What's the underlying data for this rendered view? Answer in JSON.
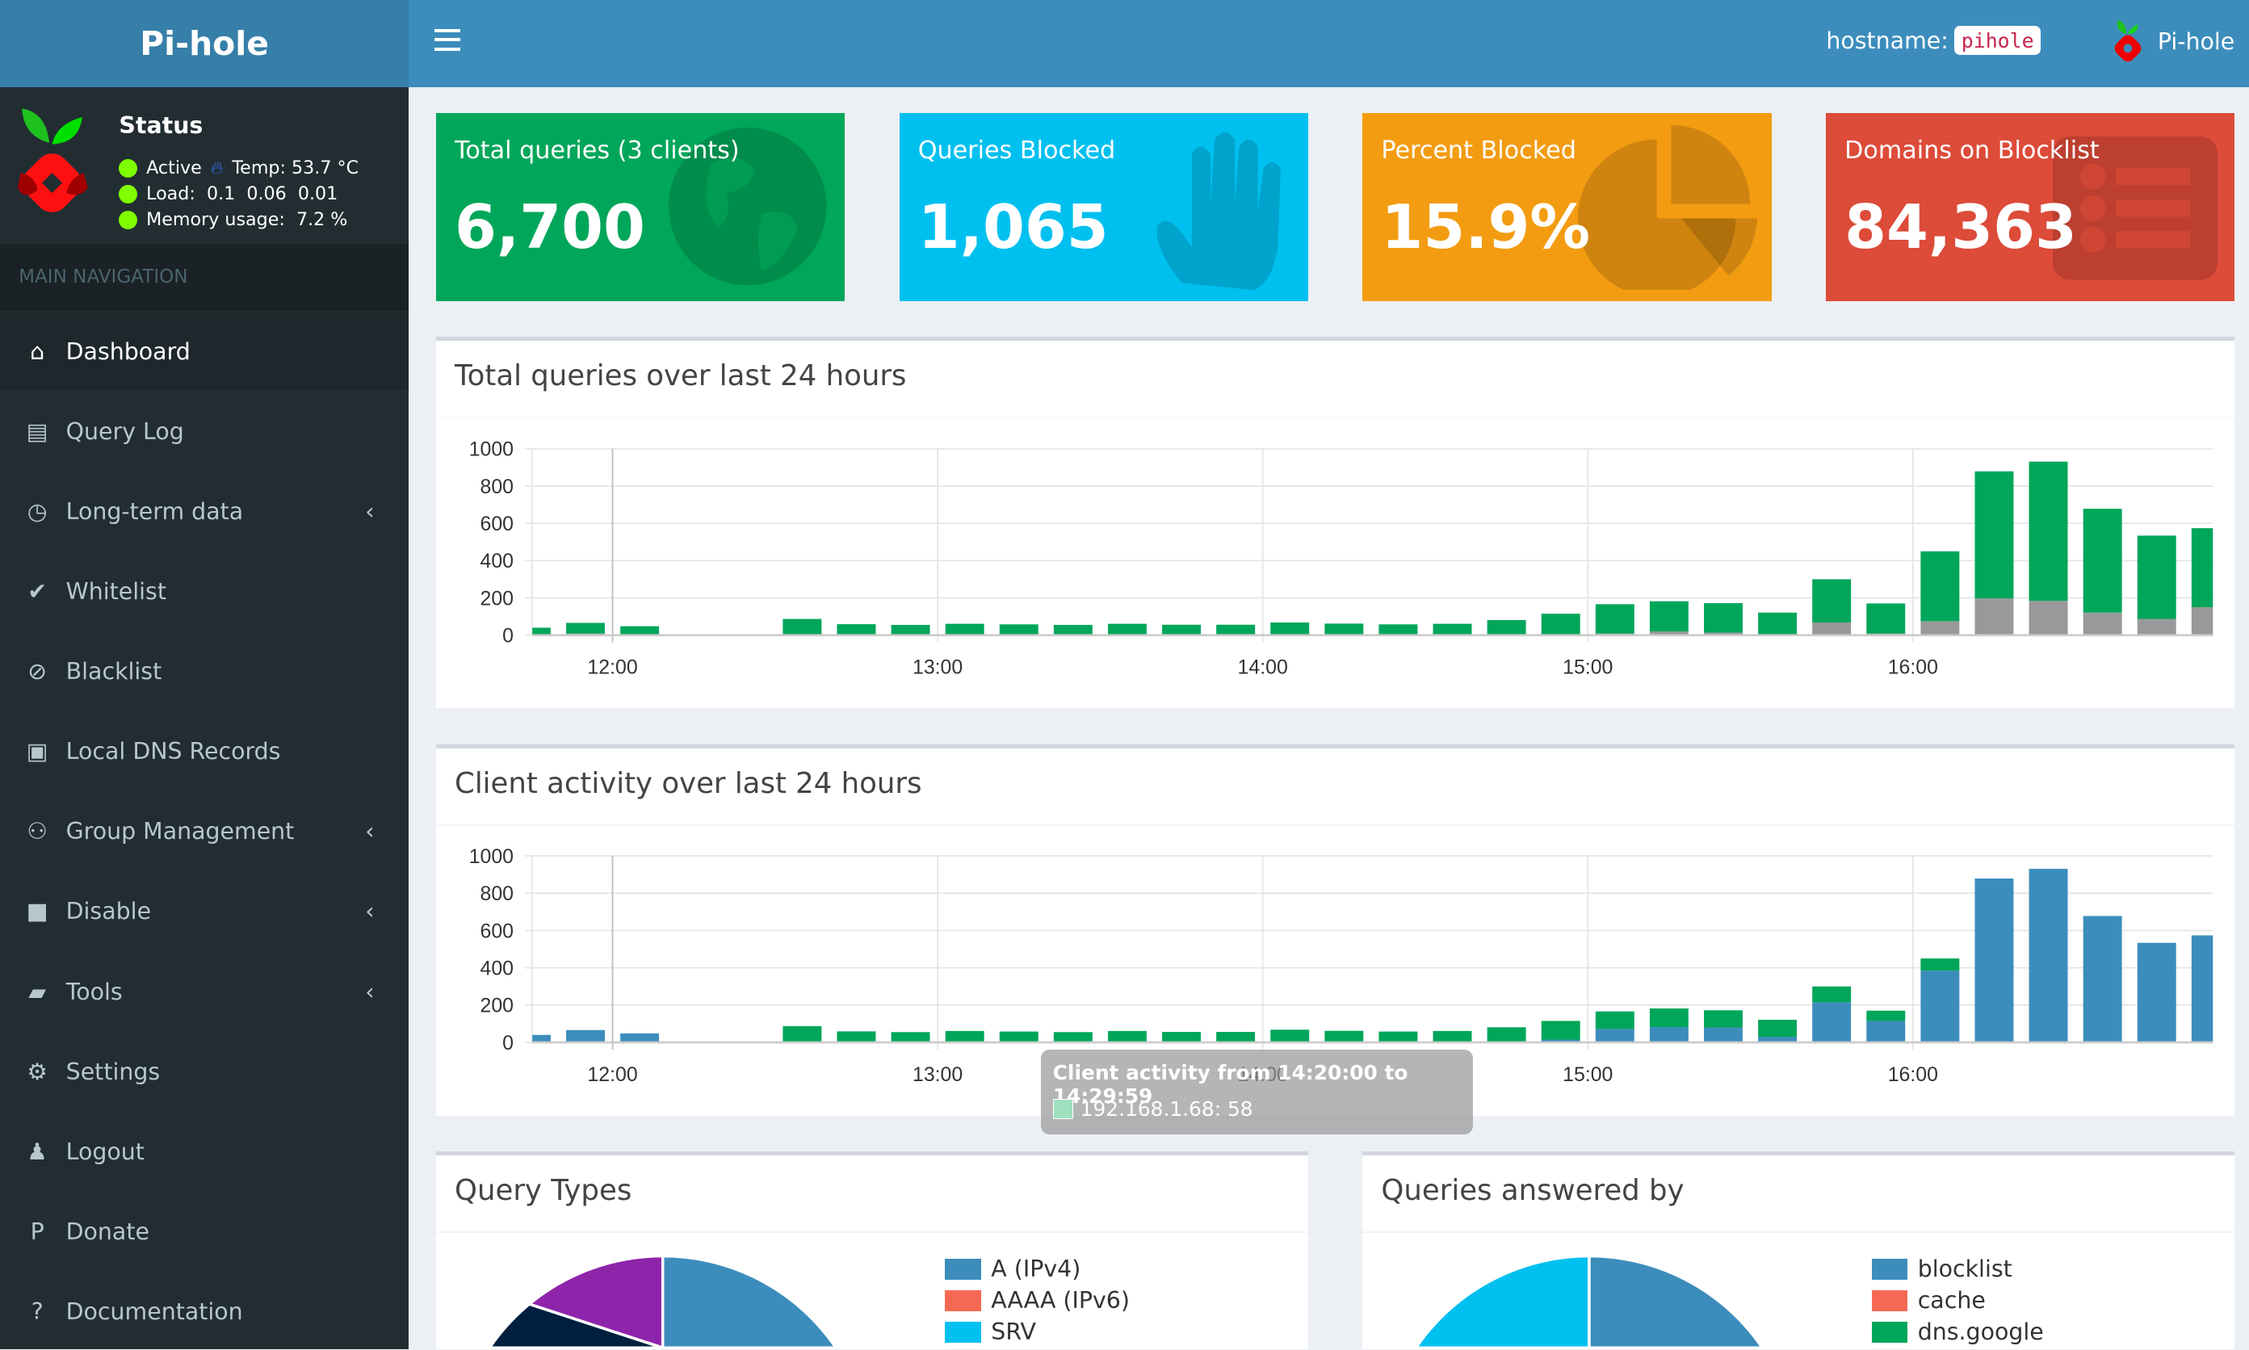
{
  "app": {
    "title": "Pi-hole",
    "user_name": "Pi-hole"
  },
  "header": {
    "hostname_label": "hostname:",
    "hostname_value": "pihole"
  },
  "status": {
    "title": "Status",
    "active": "Active",
    "temp": "Temp: 53.7 °C",
    "load": "Load:  0.1  0.06  0.01",
    "memory": "Memory usage:  7.2 %",
    "status_color": "#7fff00"
  },
  "sidebar": {
    "header": "MAIN NAVIGATION",
    "items": [
      {
        "label": "Dashboard",
        "icon": "home-icon",
        "active": true
      },
      {
        "label": "Query Log",
        "icon": "file-icon"
      },
      {
        "label": "Long-term data",
        "icon": "clock-icon",
        "chevron": true
      },
      {
        "label": "Whitelist",
        "icon": "check-circle-icon"
      },
      {
        "label": "Blacklist",
        "icon": "ban-icon"
      },
      {
        "label": "Local DNS Records",
        "icon": "address-book-icon"
      },
      {
        "label": "Group Management",
        "icon": "users-cog-icon",
        "chevron": true
      },
      {
        "label": "Disable",
        "icon": "stop-icon",
        "chevron": true
      },
      {
        "label": "Tools",
        "icon": "folder-icon",
        "chevron": true
      },
      {
        "label": "Settings",
        "icon": "cogs-icon"
      },
      {
        "label": "Logout",
        "icon": "user-times-icon"
      },
      {
        "label": "Donate",
        "icon": "paypal-icon"
      },
      {
        "label": "Documentation",
        "icon": "question-circle-icon"
      }
    ]
  },
  "stats": [
    {
      "title": "Total queries (3 clients)",
      "value": "6,700",
      "color": "#00a65a",
      "icon": "globe-icon"
    },
    {
      "title": "Queries Blocked",
      "value": "1,065",
      "color": "#00c0ef",
      "icon": "hand-icon"
    },
    {
      "title": "Percent Blocked",
      "value": "15.9%",
      "color": "#f39c12",
      "icon": "pie-chart-icon"
    },
    {
      "title": "Domains on Blocklist",
      "value": "84,363",
      "color": "#dd4b39",
      "icon": "list-icon"
    }
  ],
  "chart_data": [
    {
      "type": "bar",
      "stacked": true,
      "title": "Total queries over last 24 hours",
      "ylim": [
        0,
        1000
      ],
      "yticks": [
        "0",
        "200",
        "400",
        "600",
        "800",
        "1000"
      ],
      "xticks": [
        "12:00",
        "13:00",
        "14:00",
        "15:00",
        "16:00"
      ],
      "grid": true,
      "x": [
        "11:40",
        "11:50",
        "12:00",
        "12:30",
        "12:40",
        "12:50",
        "13:00",
        "13:10",
        "13:20",
        "13:30",
        "13:40",
        "13:50",
        "14:00",
        "14:10",
        "14:20",
        "14:30",
        "14:40",
        "14:50",
        "15:00",
        "15:10",
        "15:20",
        "15:30",
        "15:40",
        "15:50",
        "16:00",
        "16:10",
        "16:20",
        "16:30",
        "16:40",
        "16:50"
      ],
      "series": [
        {
          "color": "#999999",
          "values": [
            0,
            9,
            3,
            0,
            0,
            0,
            0,
            0,
            0,
            0,
            0,
            0,
            4,
            0,
            0,
            0,
            0,
            0,
            9,
            20,
            14,
            0,
            68,
            9,
            75,
            197,
            184,
            121,
            87,
            150
          ]
        },
        {
          "color": "#00a65a",
          "values": [
            40,
            57,
            45,
            87,
            59,
            55,
            61,
            58,
            55,
            61,
            56,
            56,
            64,
            62,
            58,
            61,
            81,
            115,
            157,
            162,
            158,
            121,
            232,
            161,
            375,
            682,
            747,
            557,
            447,
            424
          ]
        }
      ]
    },
    {
      "type": "bar",
      "stacked": true,
      "title": "Client activity over last 24 hours",
      "ylim": [
        0,
        1000
      ],
      "yticks": [
        "0",
        "200",
        "400",
        "600",
        "800",
        "1000"
      ],
      "xticks": [
        "12:00",
        "13:00",
        "14:00",
        "15:00",
        "16:00"
      ],
      "grid": true,
      "x": [
        "11:40",
        "11:50",
        "12:00",
        "12:30",
        "12:40",
        "12:50",
        "13:00",
        "13:10",
        "13:20",
        "13:30",
        "13:40",
        "13:50",
        "14:00",
        "14:10",
        "14:20",
        "14:30",
        "14:40",
        "14:50",
        "15:00",
        "15:10",
        "15:20",
        "15:30",
        "15:40",
        "15:50",
        "16:00",
        "16:10",
        "16:20",
        "16:30",
        "16:40",
        "16:50"
      ],
      "series": [
        {
          "color": "#3c8dbc",
          "values": [
            40,
            66,
            48,
            0,
            0,
            0,
            0,
            0,
            0,
            0,
            0,
            0,
            0,
            0,
            0,
            0,
            0,
            15,
            72,
            82,
            80,
            30,
            215,
            115,
            385,
            879,
            931,
            678,
            534,
            574
          ]
        },
        {
          "name": "192.168.1.68",
          "color": "#00a65a",
          "values": [
            0,
            0,
            0,
            87,
            59,
            55,
            61,
            58,
            55,
            61,
            56,
            56,
            68,
            62,
            58,
            61,
            81,
            100,
            94,
            100,
            92,
            91,
            85,
            55,
            65,
            0,
            0,
            0,
            0,
            0
          ]
        }
      ],
      "tooltip": {
        "title": "Client activity from 14:20:00 to 14:29:59",
        "item": "192.168.1.68: 58"
      }
    },
    {
      "type": "pie",
      "title": "Query Types",
      "legend": [
        {
          "label": "A (IPv4)",
          "color": "#3c8dbc"
        },
        {
          "label": "AAAA (IPv6)",
          "color": "#f56954"
        },
        {
          "label": "SRV",
          "color": "#00c0ef"
        }
      ],
      "slices": [
        {
          "color": "#3c8dbc",
          "value": 62
        },
        {
          "color": "#f56954",
          "value": 12
        },
        {
          "color": "#00c0ef",
          "value": 8
        },
        {
          "color": "#001f3f",
          "value": 7
        },
        {
          "color": "#8e24aa",
          "value": 11
        }
      ]
    },
    {
      "type": "pie",
      "title": "Queries answered by",
      "legend": [
        {
          "label": "blocklist",
          "color": "#3c8dbc"
        },
        {
          "label": "cache",
          "color": "#f56954"
        },
        {
          "label": "dns.google",
          "color": "#00a65a"
        }
      ],
      "slices": [
        {
          "color": "#3c8dbc",
          "value": 16
        },
        {
          "color": "#f56954",
          "value": 20
        },
        {
          "color": "#00a65a",
          "value": 44
        },
        {
          "color": "#00c0ef",
          "value": 20
        }
      ]
    }
  ]
}
